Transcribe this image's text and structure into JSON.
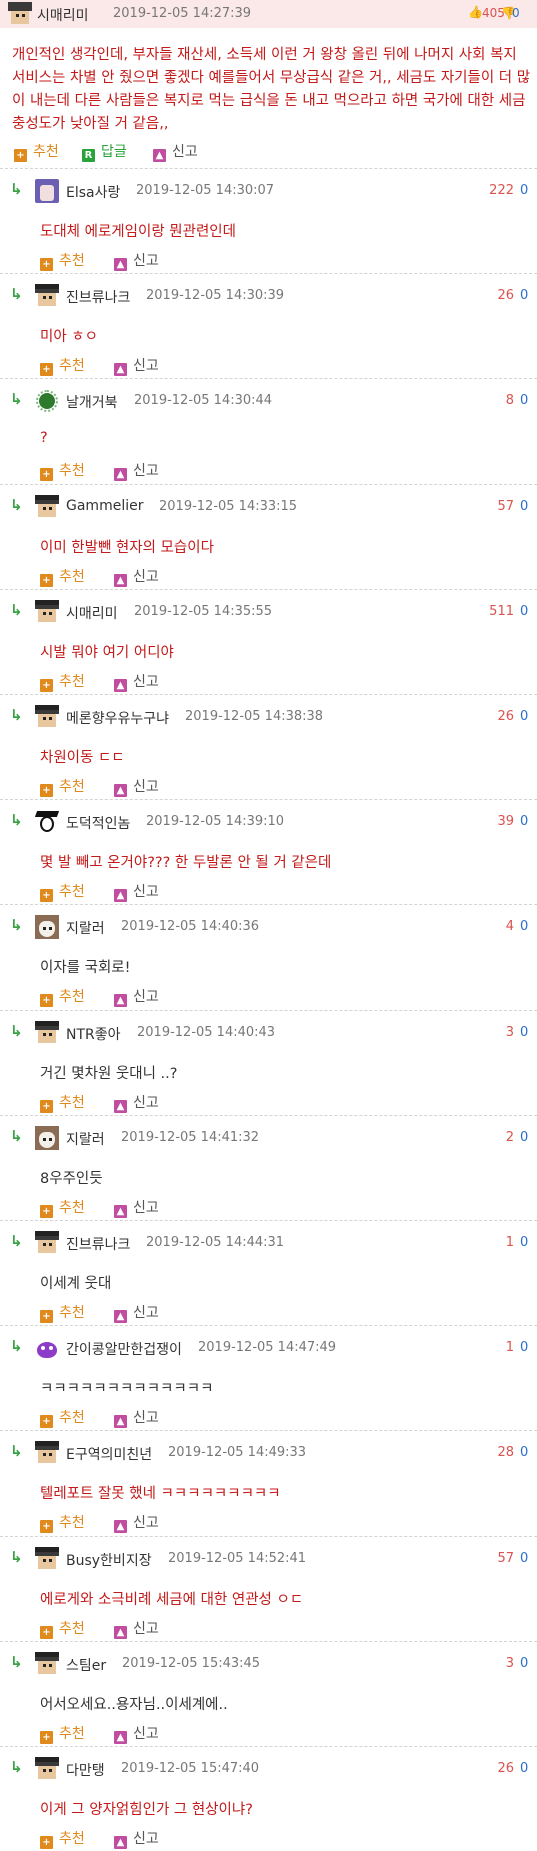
{
  "post": {
    "nickname": "시매리미",
    "datetime": "2019-12-05 14:27:39",
    "upvotes": "405",
    "downvotes": "0",
    "body": "개인적인 생각인데, 부자들 재산세, 소득세 이런 거 왕창 올린 뒤에 나머지 사회 복지 서비스는 차별 안 줬으면 좋겠다 예를들어서 무상급식 같은 거,, 세금도 자기들이 더 많이 내는데 다른 사람들은 복지로 먹는 급식을 돈 내고 먹으라고 하면 국가에 대한 세금충성도가 낮아질 거 같음,,",
    "actions": {
      "recommend": "추천",
      "reply": "답글",
      "report": "신고",
      "reply_icon": "R"
    }
  },
  "comment_actions": {
    "recommend": "추천",
    "report": "신고"
  },
  "comments": [
    {
      "nickname": "Elsa사랑",
      "datetime": "2019-12-05 14:30:07",
      "up": "222",
      "down": "0",
      "text": "도대체 에로게임이랑 뭔관련인데",
      "avatar": "anime",
      "text_color": "red"
    },
    {
      "nickname": "진브류나크",
      "datetime": "2019-12-05 14:30:39",
      "up": "26",
      "down": "0",
      "text": "미아 ㅎㅇ",
      "avatar": "pixel",
      "text_color": "red"
    },
    {
      "nickname": "날개거북",
      "datetime": "2019-12-05 14:30:44",
      "up": "8",
      "down": "0",
      "text": "?",
      "avatar": "blob",
      "text_color": "red"
    },
    {
      "nickname": "Gammelier",
      "datetime": "2019-12-05 14:33:15",
      "up": "57",
      "down": "0",
      "text": "이미 한발뺀 현자의 모습이다",
      "avatar": "pixel",
      "text_color": "red"
    },
    {
      "nickname": "시매리미",
      "datetime": "2019-12-05 14:35:55",
      "up": "511",
      "down": "0",
      "text": "시발 뭐야 여기 어디야",
      "avatar": "pixel",
      "text_color": "red"
    },
    {
      "nickname": "메론향우유누구냐",
      "datetime": "2019-12-05 14:38:38",
      "up": "26",
      "down": "0",
      "text": "차원이동 ㄷㄷ",
      "avatar": "pixel",
      "text_color": "red"
    },
    {
      "nickname": "도덕적인놈",
      "datetime": "2019-12-05 14:39:10",
      "up": "39",
      "down": "0",
      "text": "몇 발 빼고 온거야??? 한 두발론 안 될 거 같은데",
      "avatar": "grad",
      "text_color": "red"
    },
    {
      "nickname": "지랄러",
      "datetime": "2019-12-05 14:40:36",
      "up": "4",
      "down": "0",
      "text": "이자를 국회로!",
      "avatar": "cat",
      "text_color": "black"
    },
    {
      "nickname": "NTR좋아",
      "datetime": "2019-12-05 14:40:43",
      "up": "3",
      "down": "0",
      "text": "거긴 몇차원 웃대니 ..?",
      "avatar": "pixel",
      "text_color": "black"
    },
    {
      "nickname": "지랄러",
      "datetime": "2019-12-05 14:41:32",
      "up": "2",
      "down": "0",
      "text": "8우주인듯",
      "avatar": "cat",
      "text_color": "black"
    },
    {
      "nickname": "진브류나크",
      "datetime": "2019-12-05 14:44:31",
      "up": "1",
      "down": "0",
      "text": "이세계 웃대",
      "avatar": "pixel",
      "text_color": "black"
    },
    {
      "nickname": "간이콩알만한겁쟁이",
      "datetime": "2019-12-05 14:47:49",
      "up": "1",
      "down": "0",
      "text": "ㅋㅋㅋㅋㅋㅋㅋㅋㅋㅋㅋㅋㅋ",
      "avatar": "purple",
      "text_color": "black"
    },
    {
      "nickname": "E구역의미친년",
      "datetime": "2019-12-05 14:49:33",
      "up": "28",
      "down": "0",
      "text": "텔레포트 잘못 했네 ㅋㅋㅋㅋㅋㅋㅋㅋㅋ",
      "avatar": "pixel",
      "text_color": "red"
    },
    {
      "nickname": "Busy한비지장",
      "datetime": "2019-12-05 14:52:41",
      "up": "57",
      "down": "0",
      "text": "에로게와 소극비례 세금에 대한 연관성 ㅇㄷ",
      "avatar": "pixel",
      "text_color": "red"
    },
    {
      "nickname": "스팀er",
      "datetime": "2019-12-05 15:43:45",
      "up": "3",
      "down": "0",
      "text": "어서오세요..용자님..이세계에..",
      "avatar": "pixel",
      "text_color": "black"
    },
    {
      "nickname": "다만탱",
      "datetime": "2019-12-05 15:47:40",
      "up": "26",
      "down": "0",
      "text": "이게 그 양자얽힘인가 그 현상이냐?",
      "avatar": "pixel",
      "text_color": "red"
    }
  ]
}
